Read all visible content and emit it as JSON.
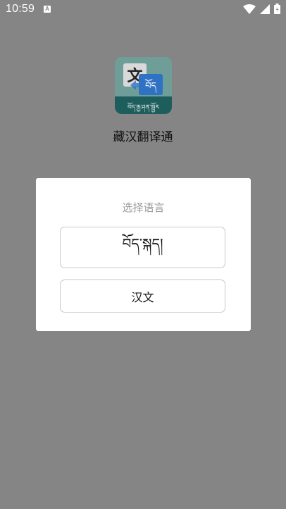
{
  "status_bar": {
    "time": "10:59",
    "notification_badge": "A",
    "icons": [
      "wifi-icon",
      "signal-icon",
      "battery-icon"
    ]
  },
  "app": {
    "name": "藏汉翻译通",
    "icon": {
      "chinese_glyph": "文",
      "tibetan_glyph": "བོད",
      "tibetan_caption": "བོད་རྒྱ་ཤན་སྦྱོར"
    }
  },
  "dialog": {
    "title": "选择语言",
    "options": [
      {
        "label": "བོད་སྐད།"
      },
      {
        "label": "汉文"
      }
    ]
  },
  "colors": {
    "overlay_background": "#858585",
    "dialog_background": "#ffffff",
    "title_text": "#9a9a9a",
    "option_border": "#c9c9c9",
    "icon_teal": "#1d6a68"
  }
}
